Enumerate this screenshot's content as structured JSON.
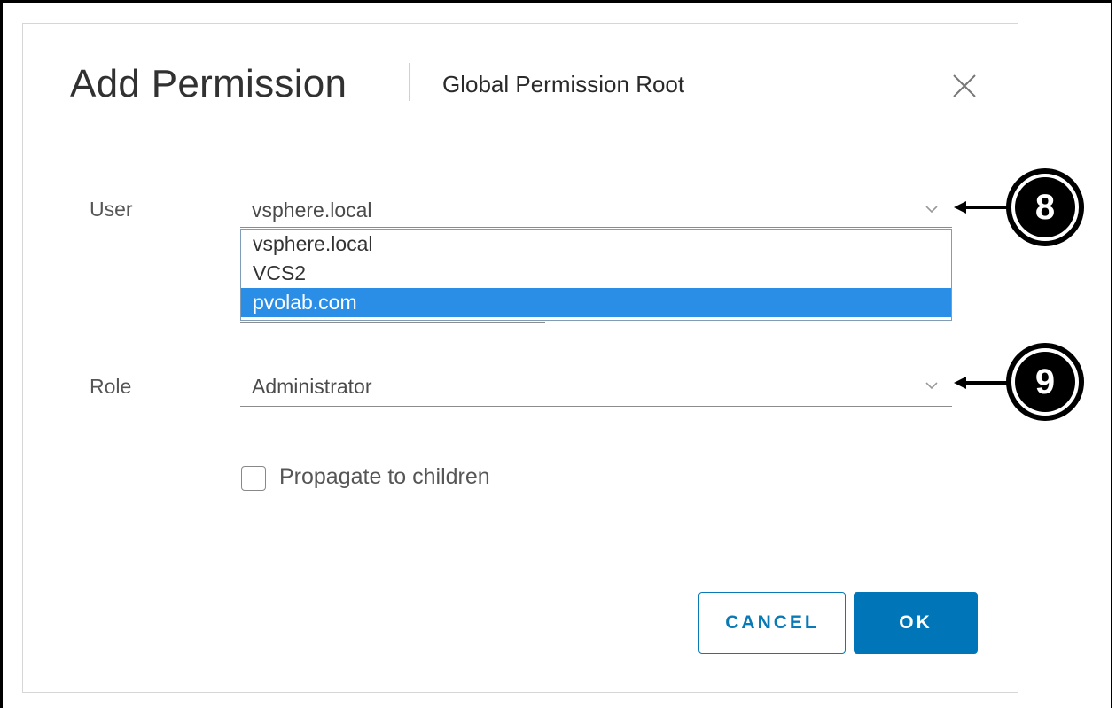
{
  "dialog": {
    "title": "Add Permission",
    "subtitle": "Global Permission Root"
  },
  "user": {
    "label": "User",
    "value": "vsphere.local",
    "options": [
      "vsphere.local",
      "VCS2",
      "pvolab.com"
    ],
    "highlighted_option": "pvolab.com"
  },
  "role": {
    "label": "Role",
    "value": "Administrator"
  },
  "propagate": {
    "label": "Propagate to children",
    "checked": false
  },
  "buttons": {
    "cancel": "CANCEL",
    "ok": "OK"
  },
  "callouts": [
    "8",
    "9"
  ],
  "icons": {
    "close": "close-icon",
    "dropdown": "chevron-down-icon"
  },
  "colors": {
    "primary": "#0076b8",
    "highlight": "#2a8ee6",
    "text": "#565656"
  }
}
